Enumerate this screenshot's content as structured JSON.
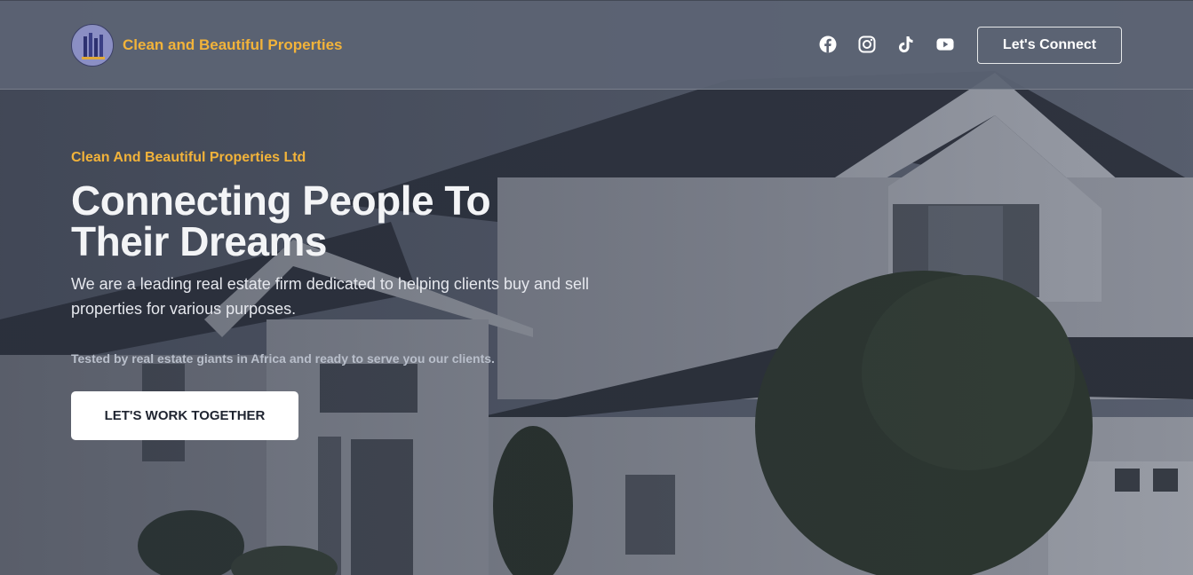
{
  "header": {
    "brand_name": "Clean and Beautiful Properties",
    "connect_label": "Let's Connect",
    "socials": [
      "facebook-icon",
      "instagram-icon",
      "tiktok-icon",
      "youtube-icon"
    ]
  },
  "hero": {
    "eyebrow": "Clean And Beautiful Properties Ltd",
    "headline": "Connecting People To Their Dreams",
    "description": "We are a leading real estate firm dedicated to helping clients buy and sell properties for various purposes.",
    "tagline": "Tested by real estate giants in Africa and ready to serve you our clients.",
    "cta_label": "LET'S WORK TOGETHER"
  },
  "colors": {
    "accent": "#f2b33a",
    "header_bg": "#5c6474",
    "cta_bg": "#ffffff"
  }
}
